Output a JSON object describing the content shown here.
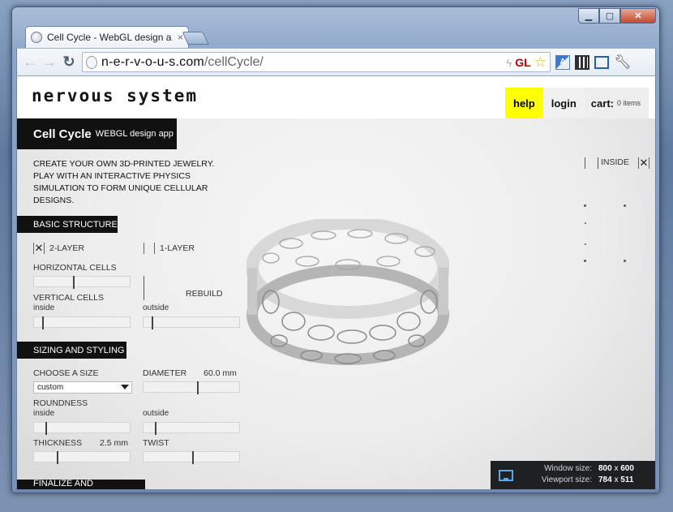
{
  "browser": {
    "tab_title": "Cell Cycle - WebGL design a",
    "tab_close": "×",
    "url_host": "n-e-r-v-o-u-s.com",
    "url_path": "/cellCycle/",
    "ext_gl": "GL",
    "back_icon": "arrow-left-icon",
    "forward_icon": "arrow-right-icon",
    "reload_icon": "reload-icon"
  },
  "site": {
    "logo": "nervous system",
    "nav": {
      "help": "help",
      "login": "login",
      "cart_label": "cart:",
      "cart_count": "0 items"
    }
  },
  "app": {
    "name": "Cell Cycle",
    "subtitle": "WEBGL design app",
    "intro": "CREATE YOUR OWN 3D-PRINTED JEWELRY. PLAY WITH AN INTERACTIVE PHYSICS SIMULATION TO FORM UNIQUE CELLULAR DESIGNS."
  },
  "basic": {
    "header": "BASIC STRUCTURE",
    "two_layer": "2-LAYER",
    "one_layer": "1-LAYER",
    "horizontal_cells": "HORIZONTAL CELLS",
    "vertical_cells": "VERTICAL CELLS",
    "inside": "inside",
    "outside": "outside",
    "rebuild": "REBUILD"
  },
  "sizing": {
    "header": "SIZING AND STYLING",
    "choose_size": "CHOOSE A SIZE",
    "size_value": "custom",
    "diameter": "DIAMETER",
    "diameter_value": "60.0 mm",
    "roundness": "ROUNDNESS",
    "inside": "inside",
    "outside": "outside",
    "thickness": "THICKNESS",
    "thickness_value": "2.5 mm",
    "twist": "TWIST"
  },
  "finalize": {
    "header": "FINALIZE AND PURCHASE"
  },
  "view": {
    "inside_label": "INSIDE"
  },
  "status": {
    "window_label": "Window size:",
    "window_w": "800",
    "window_h": "600",
    "viewport_label": "Viewport size:",
    "viewport_w": "784",
    "viewport_h": "511",
    "x": "x"
  },
  "colors": {
    "help_bg": "#ffff00",
    "bar_bg": "#111111"
  }
}
